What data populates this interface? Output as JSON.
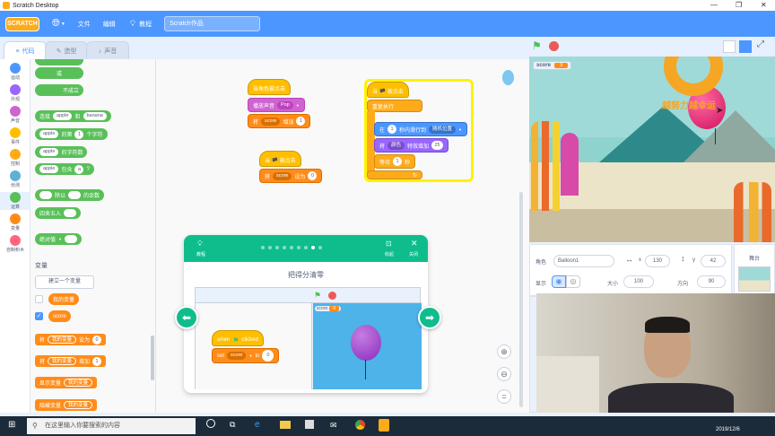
{
  "window": {
    "title": "Scratch Desktop",
    "controls": [
      "—",
      "❐",
      "✕"
    ]
  },
  "menubar": {
    "logo": "SCRATCH",
    "items": [
      "文件",
      "编辑",
      "教程"
    ],
    "project_title": "Scratch作品"
  },
  "tabs": [
    "代码",
    "造型",
    "声音"
  ],
  "categories": [
    {
      "label": "运动",
      "color": "#4c97ff"
    },
    {
      "label": "外观",
      "color": "#9966ff"
    },
    {
      "label": "声音",
      "color": "#cf63cf"
    },
    {
      "label": "事件",
      "color": "#ffbf00"
    },
    {
      "label": "控制",
      "color": "#ffab19"
    },
    {
      "label": "侦测",
      "color": "#5cb1d6"
    },
    {
      "label": "运算",
      "color": "#59c059"
    },
    {
      "label": "变量",
      "color": "#ff8c1a"
    },
    {
      "label": "自制积木",
      "color": "#ff6680"
    }
  ],
  "palette": {
    "op_or": "或",
    "op_not": "不成立",
    "join": {
      "label": "连接",
      "a": "apple",
      "mid": "和",
      "b": "banana"
    },
    "letter": {
      "a": "apple",
      "mid": "的第",
      "n": "1",
      "end": "个字符"
    },
    "length": {
      "a": "apple",
      "end": "的字符数"
    },
    "contains": {
      "a": "apple",
      "mid": "包含",
      "b": "a",
      "end": "?"
    },
    "mod": {
      "mid": "除以",
      "end": "的余数"
    },
    "round": "四舍五入",
    "abs": "绝对值",
    "variables_header": "变量",
    "make_var_button": "建立一个变量",
    "var_my": "我的变量",
    "var_score": "score",
    "set_block": {
      "label": "将",
      "var": "我的变量",
      "mid": "设为",
      "val": "0"
    },
    "change_block": {
      "label": "将",
      "var": "我的变量",
      "mid": "增加",
      "val": "1"
    },
    "show_block": {
      "label": "显示变量",
      "var": "我的变量"
    },
    "hide_block": {
      "label": "隐藏变量",
      "var": "我的变量"
    }
  },
  "script1": {
    "hat": "当角色被点击",
    "sound": {
      "label": "播放声音",
      "val": "Pop"
    },
    "change": {
      "label": "将",
      "var": "score",
      "mid": "增加",
      "val": "1"
    }
  },
  "script2": {
    "hat": "当 🏴 被点击",
    "set": {
      "label": "将",
      "var": "score",
      "mid": "设为",
      "val": "0"
    }
  },
  "script3": {
    "hat": "当 🏴 被点击",
    "forever": "重复执行",
    "glide": {
      "label": "在",
      "n": "1",
      "mid": "秒内滑行到",
      "target": "随机位置"
    },
    "effect": {
      "label": "将",
      "effect": "颜色",
      "mid": "特效增加",
      "val": "25"
    },
    "wait": {
      "label": "等待",
      "n": "1",
      "end": "秒"
    },
    "loop_arrow": "↻"
  },
  "tutorial": {
    "tutorials_label": "教程",
    "shrink_label": "收起",
    "close_label": "关闭",
    "heading": "把得分清零",
    "progress_total": 9,
    "progress_current": 8,
    "when_clicked": {
      "pre": "when",
      "post": "clicked"
    },
    "set_block": {
      "label": "set",
      "var": "score",
      "mid": "to",
      "val": "0"
    },
    "score_label": "score",
    "score_value": "0"
  },
  "stage": {
    "score_label": "score",
    "score_value": "3"
  },
  "sprite_info": {
    "sprite_label": "角色",
    "sprite_name": "Balloon1",
    "x_label": "x",
    "x_value": "130",
    "y_label": "y",
    "y_value": "42",
    "show_label": "显示",
    "size_label": "大小",
    "size_value": "100",
    "dir_label": "方向",
    "dir_value": "90"
  },
  "stage_panel": {
    "label": "舞台"
  },
  "watermark": "越努力越幸运",
  "taskbar": {
    "search_placeholder": "在这里输入你要搜索的内容",
    "date": "2019/12/6"
  }
}
